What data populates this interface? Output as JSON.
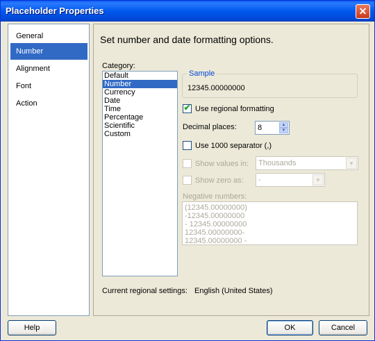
{
  "window": {
    "title": "Placeholder Properties"
  },
  "nav": {
    "items": [
      {
        "label": "General"
      },
      {
        "label": "Number"
      },
      {
        "label": "Alignment"
      },
      {
        "label": "Font"
      },
      {
        "label": "Action"
      }
    ],
    "selected": "Number"
  },
  "content": {
    "heading": "Set number and date formatting options.",
    "category_label": "Category:",
    "categories": [
      "Default",
      "Number",
      "Currency",
      "Date",
      "Time",
      "Percentage",
      "Scientific",
      "Custom"
    ],
    "selected_category": "Number",
    "sample_label": "Sample",
    "sample_value": "12345.00000000",
    "use_regional": {
      "label": "Use regional formatting",
      "checked": true
    },
    "decimal_places": {
      "label": "Decimal places:",
      "value": "8"
    },
    "use_1000_separator": {
      "label": "Use 1000 separator (,)",
      "checked": false
    },
    "show_values_in": {
      "label": "Show values in:",
      "value": "Thousands"
    },
    "show_zero_as": {
      "label": "Show zero as:",
      "value": "-"
    },
    "negative_numbers": {
      "label": "Negative numbers:",
      "items": [
        "(12345.00000000)",
        "-12345.00000000",
        "- 12345.00000000",
        "12345.00000000-",
        "12345.00000000 -"
      ]
    },
    "regional_settings_label": "Current regional settings:",
    "regional_settings_value": "English (United States)"
  },
  "buttons": {
    "help": "Help",
    "ok": "OK",
    "cancel": "Cancel"
  },
  "colors": {
    "titlebar": "#0058ee",
    "selection": "#316ac5",
    "sample_legend": "#0046d5"
  },
  "icons": {
    "close": "close-icon",
    "spin_up": "chevron-up-icon",
    "spin_down": "chevron-down-icon",
    "combo_arrow": "chevron-down-icon",
    "check": "checkmark-icon"
  }
}
